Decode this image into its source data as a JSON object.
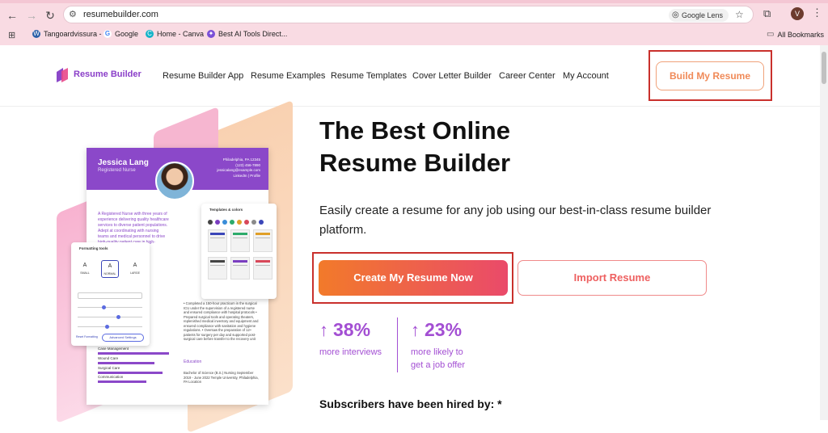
{
  "browser": {
    "url": "resumebuilder.com",
    "google_lens_label": "Google Lens",
    "profile_initial": "V",
    "bookmarks": [
      "Tangoardvissura -",
      "Google",
      "Home - Canva",
      "Best AI Tools Direct..."
    ],
    "all_bookmarks_label": "All Bookmarks"
  },
  "header": {
    "logo_text": "Resume Builder",
    "nav": [
      "Resume Builder App",
      "Resume Examples",
      "Resume Templates",
      "Cover Letter Builder",
      "Career Center",
      "My Account"
    ],
    "cta_label": "Build My Resume"
  },
  "hero": {
    "title_line1": "The Best Online",
    "title_line2": "Resume Builder",
    "subtitle": "Easily create a resume for any job using our best-in-class resume builder platform.",
    "primary_button": "Create My Resume Now",
    "secondary_button": "Import Resume",
    "stats": [
      {
        "value": "38%",
        "label_line1": "more interviews",
        "label_line2": ""
      },
      {
        "value": "23%",
        "label_line1": "more likely to",
        "label_line2": "get a job offer"
      }
    ],
    "subscribers_text": "Subscribers have been hired by: *"
  },
  "illustration": {
    "name": "Jessica Lang",
    "role": "Registered Nurse",
    "contact_lines": [
      "Philadelphia, PA 12345",
      "(123) 456-7890",
      "jessicalang@example.com",
      "LinkedIn | Profile"
    ],
    "summary": "A Registered Nurse with three years of experience delivering quality healthcare services to diverse patient populations. Adept at coordinating with nursing teams and medical personnel to drive high-quality patient care in high-pressure environments.",
    "skill_labels": [
      "Case Management",
      "Wound Care",
      "Surgical Care",
      "Communication"
    ],
    "experience_bullets": "• Completed a 150-hour practicum in the surgical ICU under the supervision of a registered nurse and ensured compliance with hospital protocols • Prepared surgical tools and operating theaters, replenished medical inventory and equipment and ensured compliance with sanitation and hygiene regulations. • Oversaw the preparation of 12+ patients for surgery per day and supported post-surgical care before transfer to the recovery unit",
    "education_heading": "Education",
    "education_text": "Bachelor of Science (B.S.) Nursing September 2019 - June 2022 Temple University, Philadelphia, PA Location",
    "formatting_title": "Formatting tools",
    "size_options": [
      "SMALL",
      "NORMAL",
      "LARGE"
    ],
    "advanced_settings_label": "Advanced Settings",
    "reset_label": "Reset Formatting",
    "templates_title": "Templates & colors"
  },
  "colors": {
    "brand_purple": "#8b48c9",
    "cta_orange": "#f27a2a",
    "cta_pink": "#ea4a6a",
    "stat_purple": "#a34fd3",
    "highlight_red": "#c9302c"
  }
}
